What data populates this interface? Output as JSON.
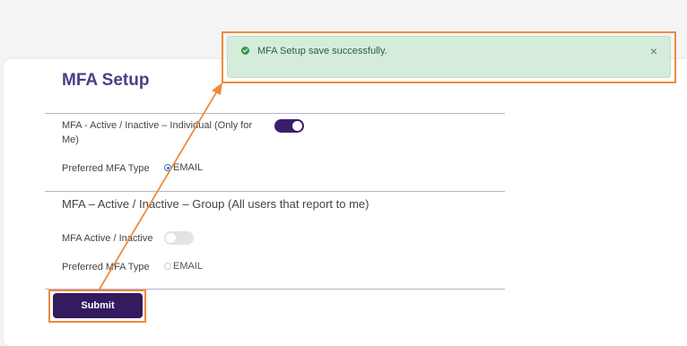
{
  "page": {
    "title": "MFA Setup"
  },
  "individual": {
    "label": "MFA - Active / Inactive – Individual (Only for Me)",
    "toggle_on": true,
    "preferred_label": "Preferred MFA Type",
    "option": "EMAIL"
  },
  "group": {
    "heading": "MFA – Active / Inactive – Group (All users that report to me)",
    "active_label": "MFA Active / Inactive",
    "toggle_on": false,
    "preferred_label": "Preferred MFA Type",
    "option": "EMAIL"
  },
  "submit_label": "Submit",
  "toast": {
    "message": "MFA Setup save successfully.",
    "close_glyph": "×"
  },
  "colors": {
    "accent": "#341a5e",
    "title": "#4a3f86",
    "highlight": "#f08a3b",
    "success_bg": "#d5ecdb"
  }
}
